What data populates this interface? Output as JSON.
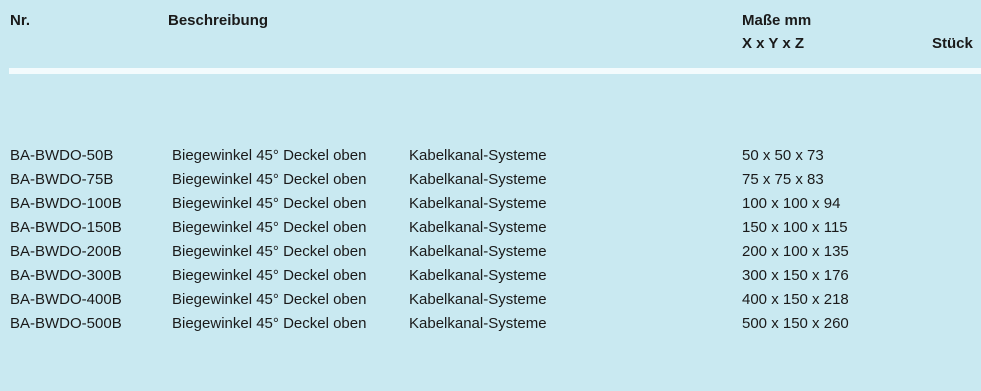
{
  "header": {
    "nr": "Nr.",
    "beschreibung": "Beschreibung",
    "masse": "Maße mm",
    "xyz": "X x Y x Z",
    "stueck": "Stück"
  },
  "rows": [
    {
      "nr": "BA-BWDO-50B",
      "desc": "Biegewinkel 45° Deckel oben",
      "cat": "Kabelkanal-Systeme",
      "dim": "50 x 50 x 73"
    },
    {
      "nr": "BA-BWDO-75B",
      "desc": "Biegewinkel 45° Deckel oben",
      "cat": "Kabelkanal-Systeme",
      "dim": "75 x 75 x 83"
    },
    {
      "nr": "BA-BWDO-100B",
      "desc": "Biegewinkel 45° Deckel oben",
      "cat": "Kabelkanal-Systeme",
      "dim": "100 x 100 x 94"
    },
    {
      "nr": "BA-BWDO-150B",
      "desc": "Biegewinkel 45° Deckel oben",
      "cat": "Kabelkanal-Systeme",
      "dim": "150 x 100 x 115"
    },
    {
      "nr": "BA-BWDO-200B",
      "desc": "Biegewinkel 45° Deckel oben",
      "cat": "Kabelkanal-Systeme",
      "dim": "200 x 100 x 135"
    },
    {
      "nr": "BA-BWDO-300B",
      "desc": "Biegewinkel 45° Deckel oben",
      "cat": "Kabelkanal-Systeme",
      "dim": "300 x 150 x 176"
    },
    {
      "nr": "BA-BWDO-400B",
      "desc": "Biegewinkel 45° Deckel oben",
      "cat": "Kabelkanal-Systeme",
      "dim": "400 x 150 x 218"
    },
    {
      "nr": "BA-BWDO-500B",
      "desc": "Biegewinkel 45° Deckel oben",
      "cat": "Kabelkanal-Systeme",
      "dim": "500 x 150 x 260"
    }
  ]
}
